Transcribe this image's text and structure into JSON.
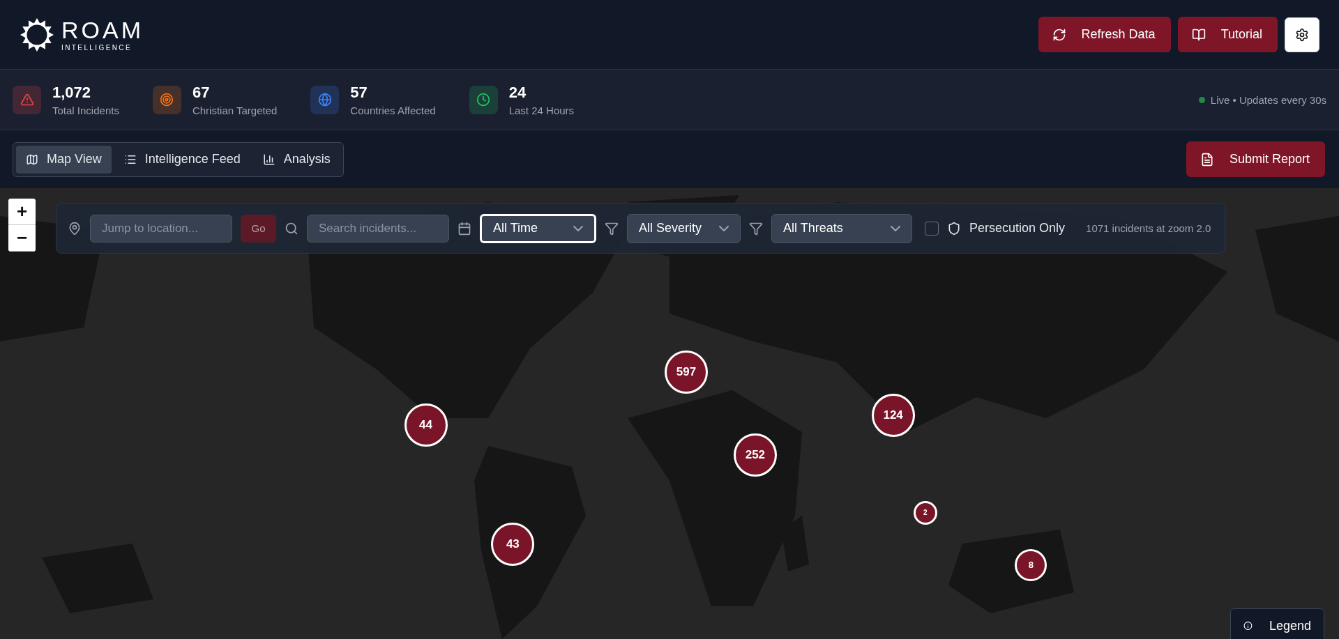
{
  "brand": {
    "name": "ROAM",
    "tagline": "INTELLIGENCE"
  },
  "header_actions": [
    {
      "kind": "refresh",
      "label": "Refresh Data"
    },
    {
      "kind": "tutorial",
      "label": "Tutorial"
    },
    {
      "kind": "settings"
    }
  ],
  "stats": [
    {
      "kind": "alert",
      "value": "1,072",
      "label": "Total Incidents",
      "color": "#ef4444"
    },
    {
      "kind": "target",
      "value": "67",
      "label": "Christian Targeted",
      "color": "#f97316"
    },
    {
      "kind": "globe",
      "value": "57",
      "label": "Countries Affected",
      "color": "#3b82f6"
    },
    {
      "kind": "clock",
      "value": "24",
      "label": "Last 24 Hours",
      "color": "#22c55e"
    }
  ],
  "live_status": {
    "text": "Live • Updates every 30s",
    "on": true
  },
  "tabs": [
    {
      "kind": "map",
      "label": "Map View",
      "selected": true
    },
    {
      "kind": "list",
      "label": "Intelligence Feed",
      "selected": false
    },
    {
      "kind": "chart",
      "label": "Analysis",
      "selected": false
    }
  ],
  "submit_button": "Submit Report",
  "zoom_controls": [
    "+",
    "−"
  ],
  "filters": {
    "location": {
      "placeholder": "Jump to location..."
    },
    "go_button": "Go",
    "search": {
      "placeholder": "Search incidents..."
    },
    "selects": [
      {
        "kind": "time",
        "value": "All Time",
        "focused": true
      },
      {
        "kind": "filter",
        "value": "All Severity",
        "focused": false
      },
      {
        "kind": "filter",
        "value": "All Threats",
        "focused": false
      }
    ],
    "persecution_only": {
      "label": "Persecution Only",
      "checked": false
    },
    "count_text": "1071 incidents at zoom 2.0"
  },
  "clusters": [
    {
      "count": "597",
      "kind": "large"
    },
    {
      "count": "44",
      "kind": "large"
    },
    {
      "count": "124",
      "kind": "large"
    },
    {
      "count": "252",
      "kind": "large"
    },
    {
      "count": "2",
      "kind": "small"
    },
    {
      "count": "43",
      "kind": "large"
    },
    {
      "count": "8",
      "kind": "medium"
    }
  ],
  "legend_button": "Legend"
}
